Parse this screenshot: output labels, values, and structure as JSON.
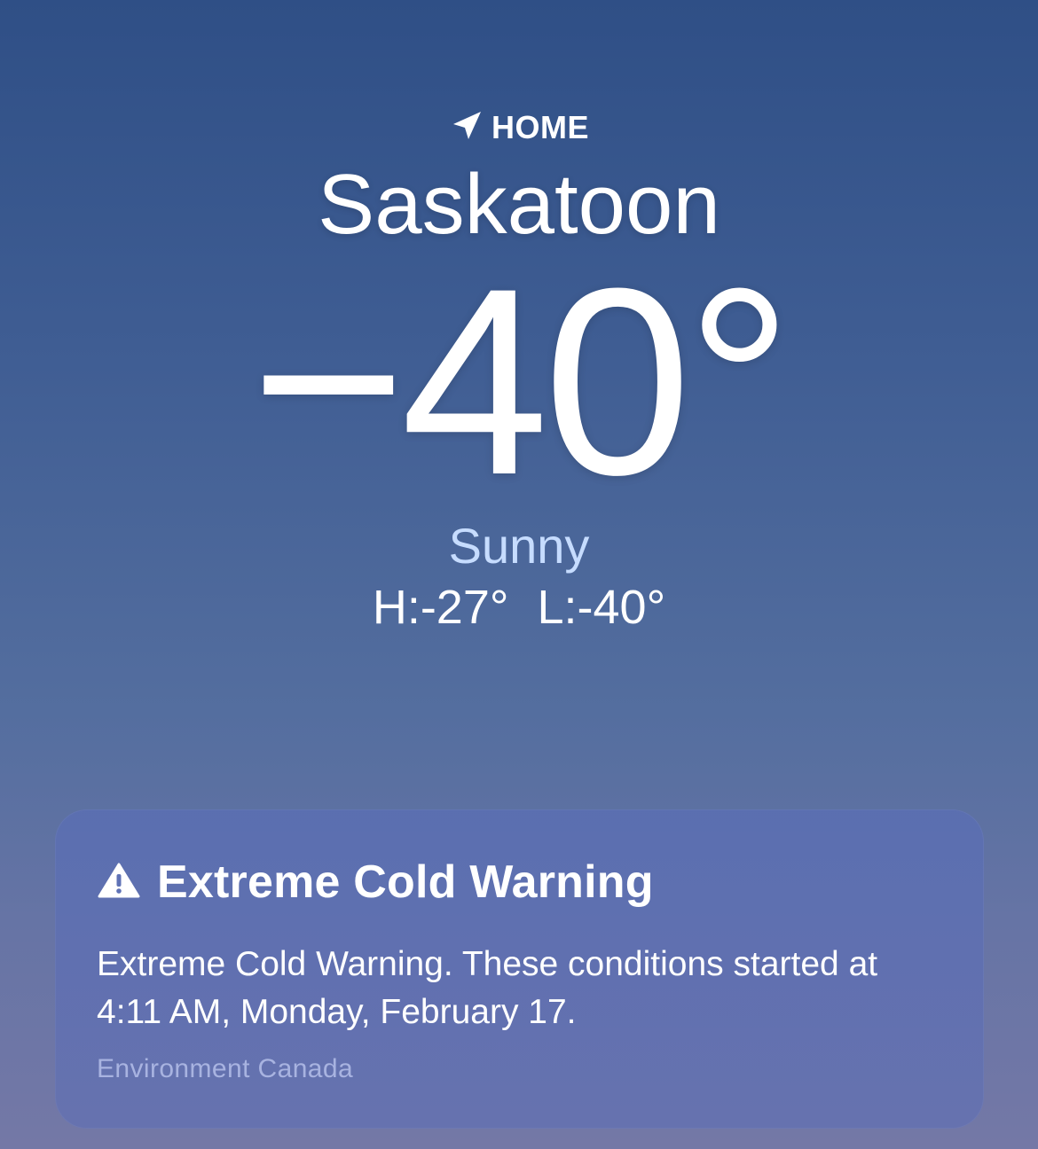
{
  "location": {
    "label": "HOME",
    "icon": "location-arrow-icon",
    "city": "Saskatoon"
  },
  "weather": {
    "temperature": "−40°",
    "condition": "Sunny",
    "high": "H:-27°",
    "low": "L:-40°"
  },
  "alert": {
    "icon": "warning-triangle-icon",
    "title": "Extreme Cold Warning",
    "description": "Extreme Cold Warning. These conditions started at 4:11 AM, Monday, February 17.",
    "source": "Environment Canada"
  },
  "colors": {
    "background_top": "#2f4f86",
    "background_bottom": "#7478a6",
    "condition_text": "#c6dcff",
    "alert_card": "#5a6eb4"
  }
}
